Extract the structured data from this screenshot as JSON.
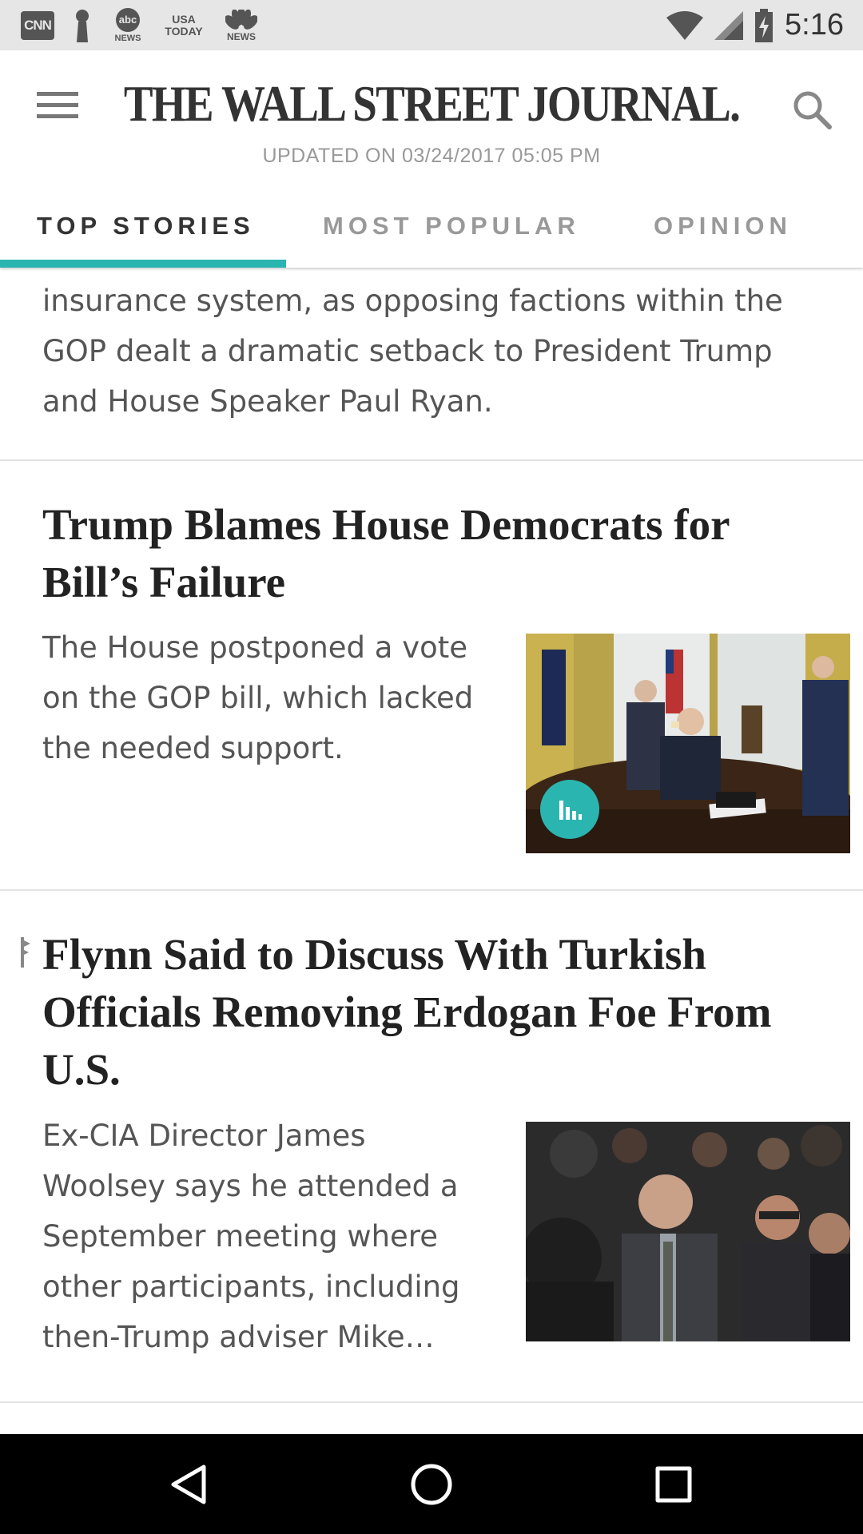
{
  "status_bar": {
    "time": "5:16",
    "notifications": {
      "cnn": "CNN",
      "abc_logo": "abc",
      "abc_sub": "NEWS",
      "usa_line1": "USA",
      "usa_line2": "TODAY",
      "nbc_sub": "NEWS"
    },
    "icons": [
      "wifi-icon",
      "signal-icon",
      "battery-charging-icon"
    ]
  },
  "header": {
    "logo": "THE WALL STREET JOURNAL.",
    "updated": "UPDATED ON 03/24/2017 05:05 PM",
    "tabs": [
      {
        "label": "TOP STORIES",
        "active": true
      },
      {
        "label": "MOST POPULAR",
        "active": false
      },
      {
        "label": "OPINION",
        "active": false
      }
    ],
    "accent_color": "#2ab5b0"
  },
  "feed": {
    "partial_story": {
      "lines": [
        "insurance system, as opposing factions within the",
        "GOP dealt a dramatic setback to President Trump",
        "and House Speaker Paul Ryan."
      ]
    },
    "stories": [
      {
        "headline_lines": [
          "Trump Blames House Democrats for",
          "Bill’s Failure"
        ],
        "summary_lines": [
          "The House postponed a vote",
          "on the GOP bill, which lacked",
          "the needed support."
        ],
        "image": "oval-office-photo",
        "badge": "chart-icon"
      },
      {
        "headline_lines": [
          "Flynn Said to Discuss With Turkish",
          "Officials Removing Erdogan Foe From",
          "U.S."
        ],
        "summary_lines": [
          "Ex-CIA Director James",
          "Woolsey says he attended a",
          "September meeting where",
          "other participants, including",
          "then-Trump adviser Mike…"
        ],
        "image": "flynn-photo",
        "marker": "flag-icon"
      }
    ]
  },
  "nav_bar": {
    "buttons": [
      "back-icon",
      "home-icon",
      "recents-icon"
    ]
  }
}
